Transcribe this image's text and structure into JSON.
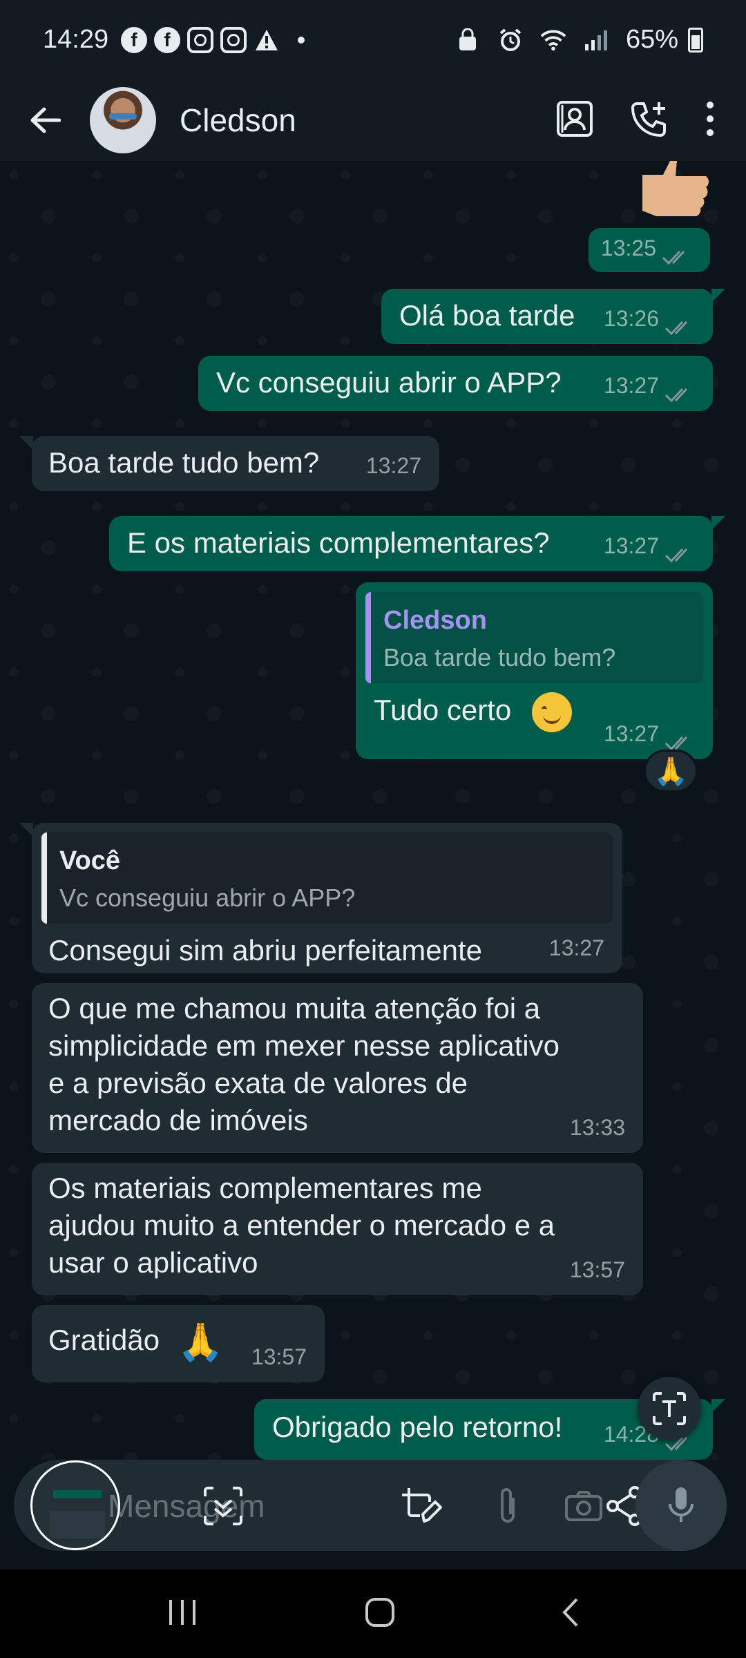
{
  "status_bar": {
    "time": "14:29",
    "battery": "65%",
    "notification_icons": [
      "facebook-icon",
      "facebook-icon",
      "instagram-icon",
      "instagram-icon",
      "warning-icon",
      "dot-icon"
    ],
    "system_icons": [
      "alarm-lock-icon",
      "alarm-icon",
      "wifi-icon",
      "signal-icon",
      "battery-icon"
    ]
  },
  "header": {
    "contact_name": "Cledson",
    "actions": [
      "video-call-icon",
      "add-call-icon",
      "more-icon"
    ]
  },
  "messages": [
    {
      "direction": "out",
      "sticker": "thumbs-up",
      "time": "13:25"
    },
    {
      "direction": "out",
      "text": "Olá boa tarde",
      "time": "13:26"
    },
    {
      "direction": "out",
      "text": "Vc conseguiu abrir o APP?",
      "time": "13:27"
    },
    {
      "direction": "in",
      "text": "Boa tarde tudo bem?",
      "time": "13:27"
    },
    {
      "direction": "out",
      "text": "E os materiais complementares?",
      "time": "13:27"
    },
    {
      "direction": "out",
      "quote_author": "Cledson",
      "quote_text": "Boa tarde tudo bem?",
      "text": "Tudo certo",
      "emoji": "smiling-face",
      "time": "13:27",
      "reaction": "🙏"
    },
    {
      "direction": "in",
      "quote_author": "Você",
      "quote_text": "Vc conseguiu abrir o APP?",
      "text": "Consegui sim abriu perfeitamente",
      "time": "13:27"
    },
    {
      "direction": "in",
      "lines": [
        "O que me chamou muita atenção foi a",
        "simplicidade em mexer nesse aplicativo",
        "e a previsão exata de valores de",
        "mercado de imóveis"
      ],
      "time": "13:33"
    },
    {
      "direction": "in",
      "lines": [
        "Os materiais complementares me",
        "ajudou muito a entender o mercado e a",
        "usar o aplicativo"
      ],
      "time": "13:57"
    },
    {
      "direction": "in",
      "text": "Gratidão",
      "emoji": "🙏",
      "time": "13:57"
    },
    {
      "direction": "out",
      "text": "Obrigado pelo retorno!",
      "time": "14:28"
    }
  ],
  "input": {
    "placeholder": "Mensagem"
  },
  "colors": {
    "outgoing": "#005c4b",
    "incoming": "#202c33",
    "background": "#0b141a",
    "header": "#121b22",
    "quote_bar": "#a593f2"
  }
}
